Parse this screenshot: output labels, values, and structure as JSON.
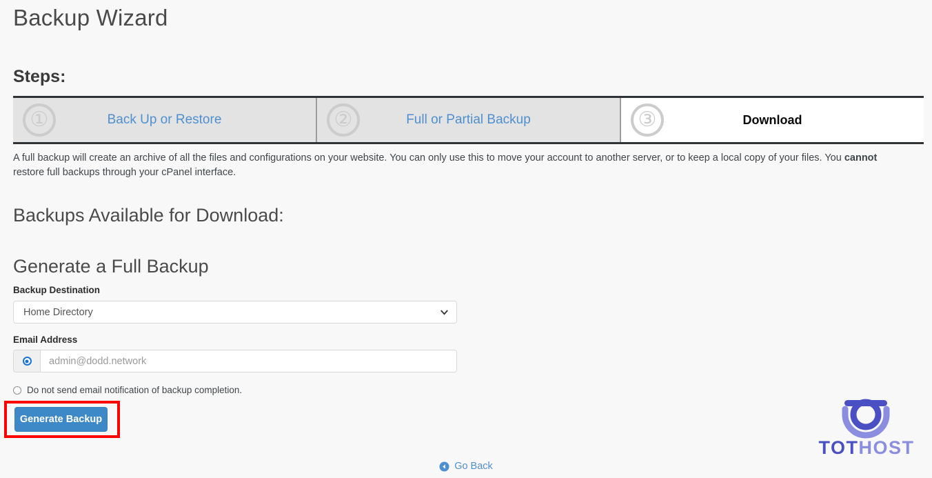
{
  "page": {
    "title": "Backup Wizard",
    "steps_heading": "Steps:"
  },
  "steps": [
    {
      "number": "①",
      "label": "Back Up or Restore",
      "active": false
    },
    {
      "number": "②",
      "label": "Full or Partial Backup",
      "active": false
    },
    {
      "number": "③",
      "label": "Download",
      "active": true
    }
  ],
  "description": {
    "part1": "A full backup will create an archive of all the files and configurations on your website. You can only use this to move your account to another server, or to keep a local copy of your files. You ",
    "emphasis": "cannot",
    "part2": " restore full backups through your cPanel interface."
  },
  "sections": {
    "available_heading": "Backups Available for Download:",
    "generate_heading": "Generate a Full Backup"
  },
  "form": {
    "destination_label": "Backup Destination",
    "destination_value": "Home Directory",
    "destination_icon": "chevron-down-icon",
    "email_label": "Email Address",
    "email_placeholder": "admin@dodd.network",
    "email_radio_selected": true,
    "no_email_label": "Do not send email notification of backup completion.",
    "no_email_radio_selected": false,
    "generate_button": "Generate Backup"
  },
  "footer": {
    "go_back_label": "Go Back",
    "go_back_icon": "arrow-circle-left-icon"
  },
  "logo": {
    "text_primary": "TOT",
    "text_secondary": "HOST"
  },
  "colors": {
    "accent_blue": "#3d88c6",
    "link_blue": "#4f8fd0",
    "annotation_red": "#ff0000",
    "logo_dark": "#4b4fc4",
    "logo_light": "#8a8de0",
    "page_background": "#f8f8f8"
  }
}
